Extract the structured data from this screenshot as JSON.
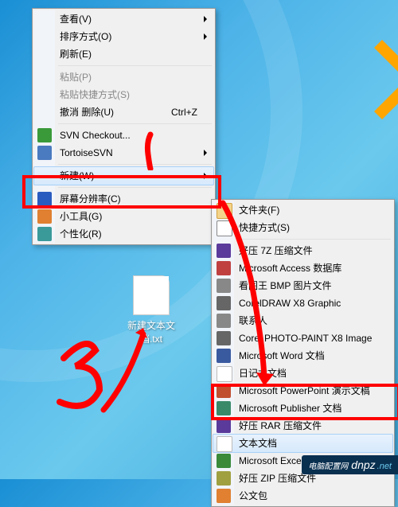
{
  "desktop": {
    "file_name": "新建文本文\n档.txt"
  },
  "menu1": {
    "items": [
      {
        "label": "查看(V)",
        "icon": null,
        "arrow": true
      },
      {
        "label": "排序方式(O)",
        "icon": null,
        "arrow": true
      },
      {
        "label": "刷新(E)",
        "icon": null
      },
      {
        "sep": true
      },
      {
        "label": "粘贴(P)",
        "icon": null,
        "disabled": true
      },
      {
        "label": "粘贴快捷方式(S)",
        "icon": null,
        "disabled": true
      },
      {
        "label": "撤消 删除(U)",
        "shortcut": "Ctrl+Z"
      },
      {
        "sep": true
      },
      {
        "label": "SVN Checkout...",
        "icon": "green"
      },
      {
        "label": "TortoiseSVN",
        "icon": "blue1",
        "arrow": true
      },
      {
        "sep": true
      },
      {
        "label": "新建(W)",
        "icon": null,
        "arrow": true,
        "hover": true
      },
      {
        "sep": true
      },
      {
        "label": "屏幕分辨率(C)",
        "icon": "blue2"
      },
      {
        "label": "小工具(G)",
        "icon": "orange"
      },
      {
        "label": "个性化(R)",
        "icon": "teal"
      }
    ]
  },
  "menu2": {
    "items": [
      {
        "label": "文件夹(F)",
        "icon": "folder"
      },
      {
        "label": "快捷方式(S)",
        "icon": "shortcut-ico"
      },
      {
        "sep": true
      },
      {
        "label": "好压 7Z 压缩文件",
        "icon": "rar"
      },
      {
        "label": "Microsoft Access 数据库",
        "icon": "red"
      },
      {
        "label": "看图王 BMP 图片文件",
        "icon": "gray1"
      },
      {
        "label": "CorelDRAW X8 Graphic",
        "icon": "gray2"
      },
      {
        "label": "联系人",
        "icon": "gray1"
      },
      {
        "label": "Corel PHOTO-PAINT X8 Image",
        "icon": "gray2"
      },
      {
        "label": "Microsoft Word 文档",
        "icon": "docblue"
      },
      {
        "label": "日记本文档",
        "icon": "txt"
      },
      {
        "label": "Microsoft PowerPoint 演示文稿",
        "icon": "ppt"
      },
      {
        "label": "Microsoft Publisher 文档",
        "icon": "pub"
      },
      {
        "label": "好压 RAR 压缩文件",
        "icon": "rar"
      },
      {
        "label": "文本文档",
        "icon": "txt",
        "hover": true
      },
      {
        "label": "Microsoft Excel 工作表",
        "icon": "xls"
      },
      {
        "label": "好压 ZIP 压缩文件",
        "icon": "zip"
      },
      {
        "label": "公文包",
        "icon": "orange"
      }
    ]
  },
  "watermark": {
    "main": "dnpz",
    "sub": ".net",
    "prefix": "电脑配置网"
  }
}
